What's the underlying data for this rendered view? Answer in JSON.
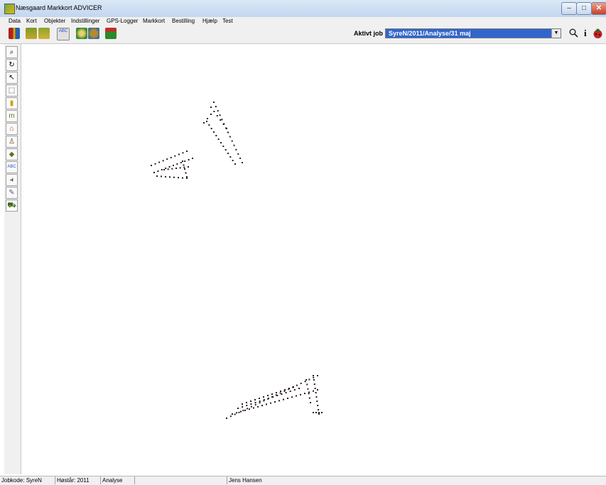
{
  "window": {
    "title": "Næsgaard Markkort ADVICER"
  },
  "menu": [
    "Data",
    "Kort",
    "Objekter",
    "Indstillinger",
    "GPS-Logger",
    "Markkort",
    "Bestilling",
    "Hjælp",
    "Test"
  ],
  "toolbar": {
    "aktivt_label": "Aktivt job",
    "job_value": "SyreN/2011/Analyse/31 maj"
  },
  "status": {
    "jobkode": "Jobkode: SyreN",
    "hoestaar": "Høstår: 2011",
    "type": "Analyse",
    "empty": "",
    "user": "Jens Hansen"
  },
  "colors": {
    "selection": "#3166cd",
    "chrome": "#f0f0f0",
    "points": "#2a1a1a"
  }
}
